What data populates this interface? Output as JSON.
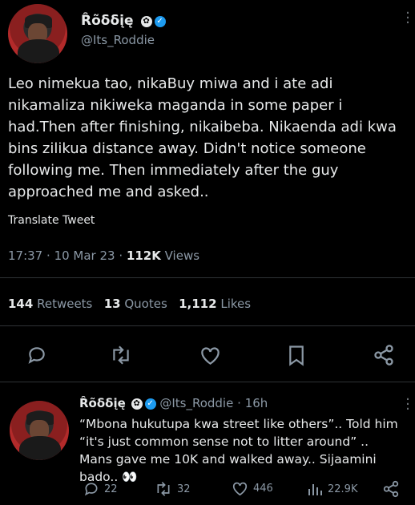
{
  "main_tweet": {
    "author_name": "Ȓõδδįę",
    "author_handle": "@Its_Roddie",
    "text": "Leo nimekua tao, nikaBuy miwa and i ate adi nikamaliza nikiweka maganda in some paper i had.Then after finishing, nikaibeba. Nikaenda adi kwa bins zilikua distance away. Didn't notice someone following me. Then immediately after the guy approached me and asked..",
    "translate_label": "Translate Tweet",
    "time": "17:37",
    "date": "10 Mar 23",
    "views_count": "112K",
    "views_label": "Views",
    "retweets_count": "144",
    "retweets_label": "Retweets",
    "quotes_count": "13",
    "quotes_label": "Quotes",
    "likes_count": "1,112",
    "likes_label": "Likes"
  },
  "reply": {
    "author_name": "Ȓõδδįę",
    "author_handle": "@Its_Roddie",
    "time_ago": "16h",
    "text": "“Mbona hukutupa kwa street like others”.. Told him “it's just common sense not to litter around” .. Mans gave me 10K and walked away.. Sijaamini bado.. 👀",
    "replies": "22",
    "retweets": "32",
    "likes": "446",
    "views": "22.9K"
  },
  "colors": {
    "background": "#000000",
    "text": "#e7e9ea",
    "muted": "#8b98a5",
    "verified": "#1d9bf0",
    "divider": "#2f3336"
  }
}
